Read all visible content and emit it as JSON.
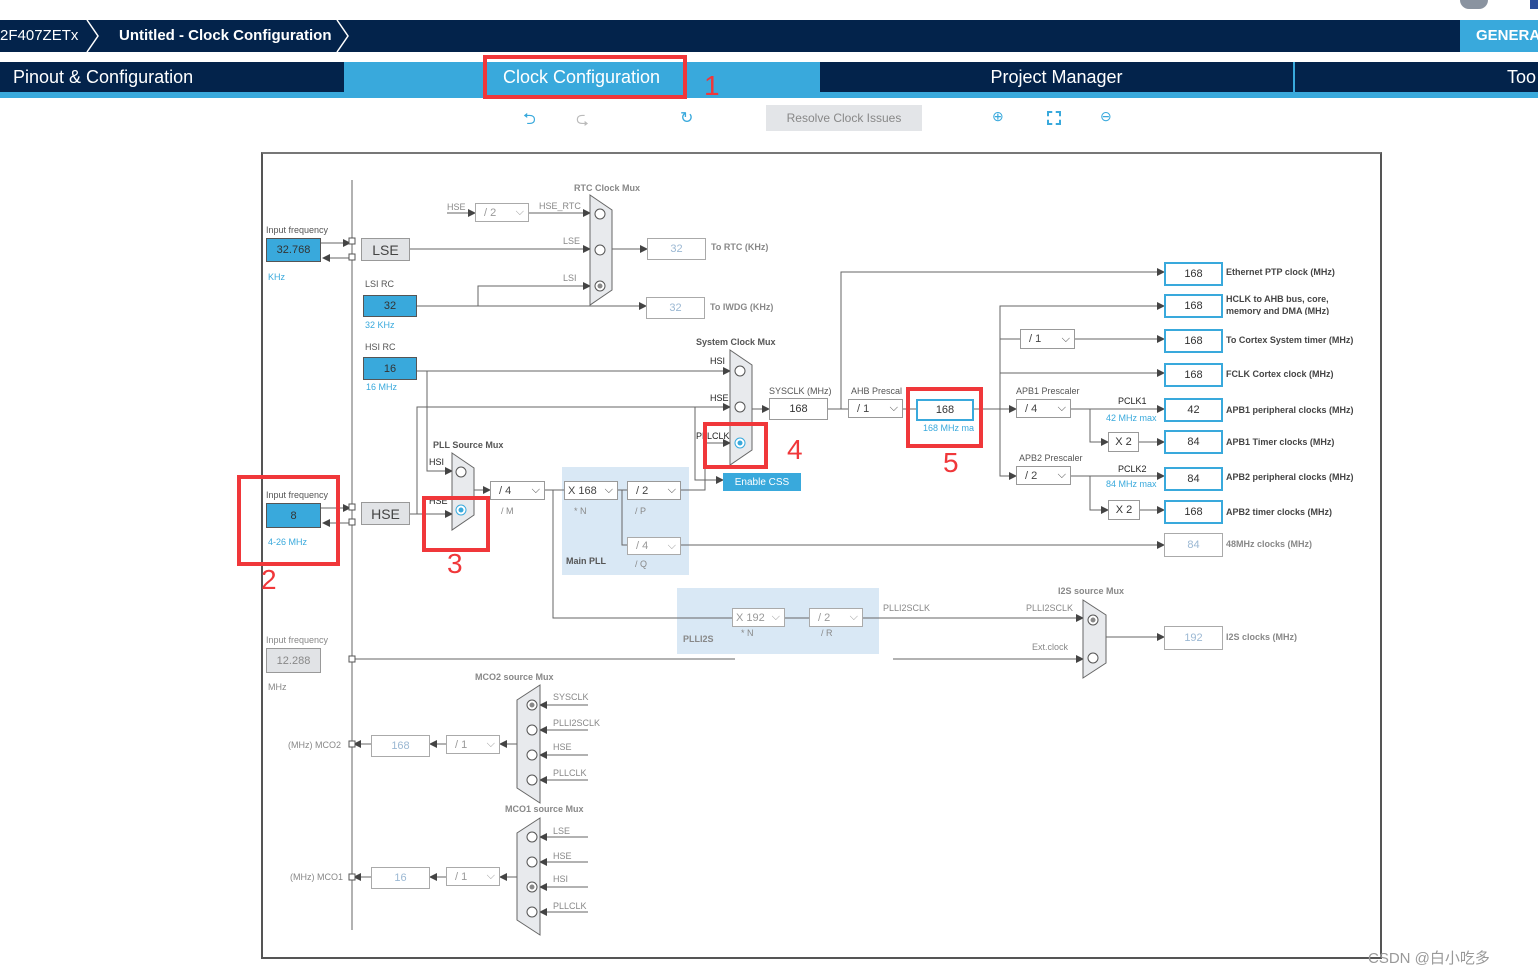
{
  "header": {
    "breadcrumb": [
      "2F407ZETx",
      "Untitled - Clock Configuration"
    ],
    "generate_label": "GENERA"
  },
  "tabs": [
    {
      "label": "Pinout & Configuration"
    },
    {
      "label": "Clock Configuration",
      "active": true
    },
    {
      "label": "Project Manager"
    },
    {
      "label": "Too"
    }
  ],
  "toolbar": {
    "resolve_label": "Resolve Clock Issues",
    "icons": [
      "undo-icon",
      "redo-icon",
      "refresh-icon",
      "zoom-in-icon",
      "fit-icon",
      "zoom-out-icon"
    ]
  },
  "annotations": [
    "1",
    "2",
    "3",
    "4",
    "5"
  ],
  "colors": {
    "navy": "#03234b",
    "accent": "#39a9dc",
    "annotation": "#f0373a"
  },
  "inputs": {
    "lse": {
      "label": "Input frequency",
      "value": "32.768",
      "unit": "KHz",
      "name": "LSE"
    },
    "lsi": {
      "label": "LSI RC",
      "value": "32",
      "unit": "32 KHz"
    },
    "hsi": {
      "label": "HSI RC",
      "value": "16",
      "unit": "16 MHz"
    },
    "hse": {
      "label": "Input frequency",
      "value": "8",
      "unit": "4-26 MHz",
      "name": "HSE"
    },
    "ext": {
      "label": "Input frequency",
      "value": "12.288",
      "unit": "MHz"
    }
  },
  "rtc": {
    "title": "RTC Clock Mux",
    "hse": "HSE",
    "div": "/ 2",
    "hse_rtc": "HSE_RTC",
    "lse": "LSE",
    "lsi": "LSI",
    "rtc_value": "32",
    "rtc_label": "To RTC (KHz)",
    "iwdg_value": "32",
    "iwdg_label": "To IWDG (KHz)"
  },
  "sysmux": {
    "title": "System Clock Mux",
    "hsi": "HSI",
    "hse": "HSE",
    "pllclk": "PLLCLK",
    "css": "Enable CSS",
    "selected": "PLLCLK"
  },
  "pllsrc": {
    "title": "PLL Source Mux",
    "hsi": "HSI",
    "hse": "HSE",
    "selected": "HSE"
  },
  "pll": {
    "title": "Main PLL",
    "m": "/ 4",
    "m_label": "/ M",
    "n": "X 168",
    "n_label": "* N",
    "p": "/ 2",
    "p_label": "/ P",
    "q": "/ 4",
    "q_label": "/ Q"
  },
  "plli2s": {
    "title": "PLLI2S",
    "n": "X 192",
    "n_label": "* N",
    "r": "/ 2",
    "r_label": "/ R",
    "out": "PLLI2SCLK"
  },
  "sysclk": {
    "label": "SYSCLK (MHz)",
    "value": "168"
  },
  "ahb": {
    "label": "AHB Prescal",
    "value": "/ 1"
  },
  "hclk": {
    "value": "168",
    "max": "168 MHz ma"
  },
  "apb1": {
    "label": "APB1 Prescaler",
    "value": "/ 4",
    "pclk": "PCLK1",
    "max": "42 MHz max",
    "x2": "X 2"
  },
  "apb2": {
    "label": "APB2 Prescaler",
    "value": "/ 2",
    "pclk": "PCLK2",
    "max": "84 MHz max",
    "x2": "X 2"
  },
  "systick_div": "/ 1",
  "outputs": [
    {
      "value": "168",
      "label": "Ethernet PTP clock (MHz)"
    },
    {
      "value": "168",
      "label": "HCLK to AHB bus, core, memory and DMA (MHz)"
    },
    {
      "value": "168",
      "label": "To Cortex System timer (MHz)"
    },
    {
      "value": "168",
      "label": "FCLK Cortex clock (MHz)"
    },
    {
      "value": "42",
      "label": "APB1 peripheral clocks (MHz)"
    },
    {
      "value": "84",
      "label": "APB1 Timer clocks (MHz)"
    },
    {
      "value": "84",
      "label": "APB2 peripheral clocks (MHz)"
    },
    {
      "value": "168",
      "label": "APB2 timer clocks (MHz)"
    },
    {
      "value": "84",
      "label": "48MHz clocks (MHz)"
    },
    {
      "value": "192",
      "label": "I2S clocks (MHz)"
    }
  ],
  "i2s": {
    "title": "I2S source Mux",
    "pll": "PLLI2SCLK",
    "ext": "Ext.clock"
  },
  "mco2": {
    "title": "MCO2 source Mux",
    "inputs": [
      "SYSCLK",
      "PLLI2SCLK",
      "HSE",
      "PLLCLK"
    ],
    "div": "/ 1",
    "value": "168",
    "label": "(MHz) MCO2"
  },
  "mco1": {
    "title": "MCO1 source Mux",
    "inputs": [
      "LSE",
      "HSE",
      "HSI",
      "PLLCLK"
    ],
    "div": "/ 1",
    "value": "16",
    "label": "(MHz) MCO1"
  },
  "watermark": "CSDN @白小吃多"
}
